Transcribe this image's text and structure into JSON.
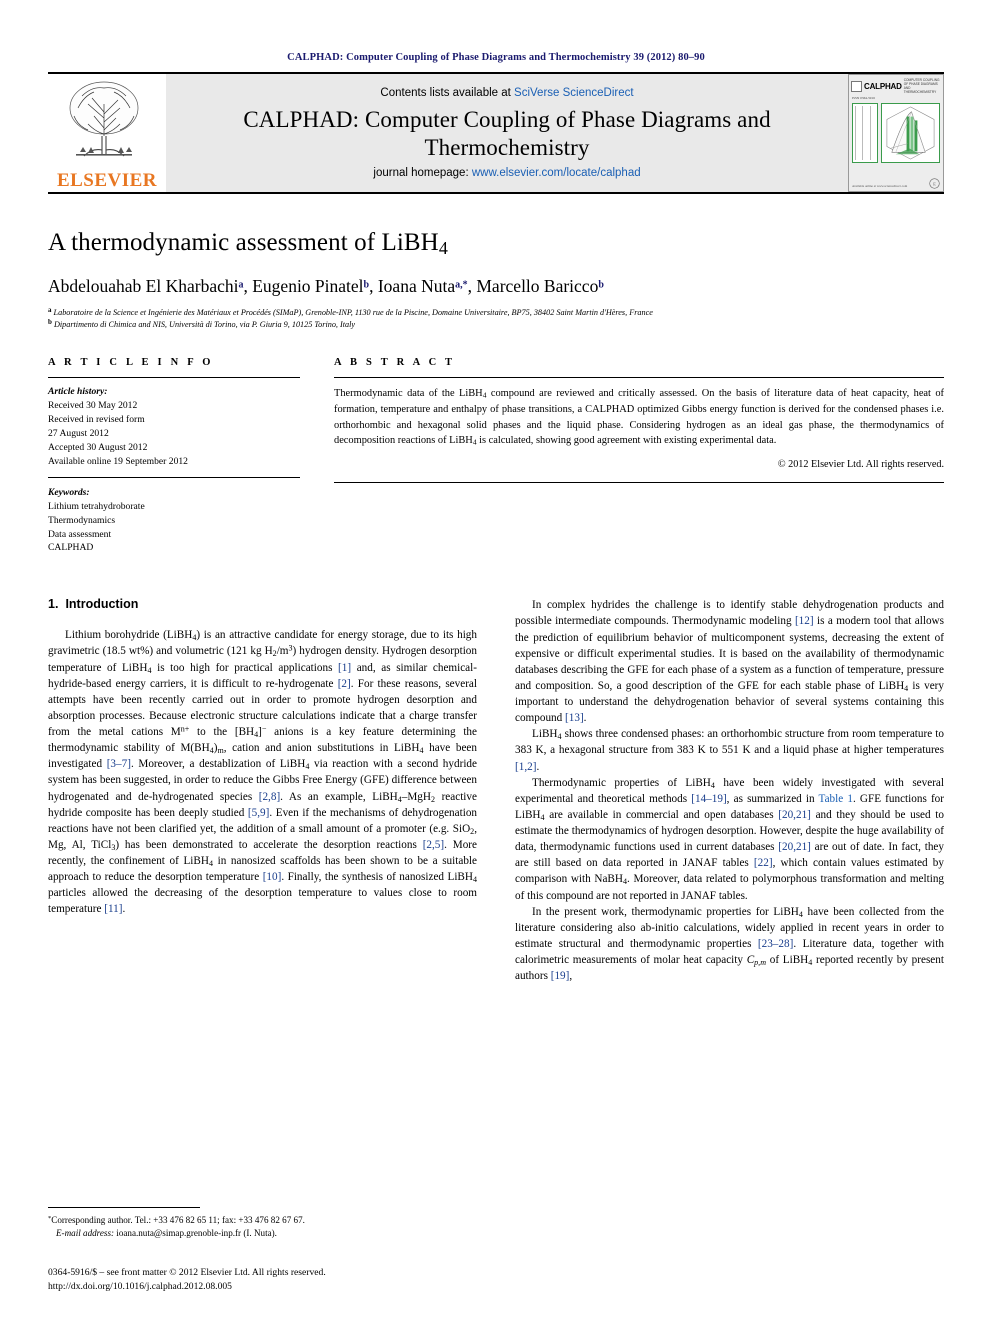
{
  "running_head": "CALPHAD: Computer Coupling of Phase Diagrams and Thermochemistry 39 (2012) 80–90",
  "masthead": {
    "publisher": "ELSEVIER",
    "contents_prefix": "Contents lists available at ",
    "contents_link": "SciVerse ScienceDirect",
    "journal_title": "CALPHAD: Computer Coupling of Phase Diagrams and Thermochemistry",
    "homepage_prefix": "journal homepage: ",
    "homepage_link": "www.elsevier.com/locate/calphad",
    "cover": {
      "brand": "CALPHAD",
      "brand_sub": "COMPUTER COUPLING OF PHASE DIAGRAMS AND THERMOCHEMISTRY",
      "meta": "ISSN 0364-5916",
      "footer_left": "Available online at\nwww.sciencedirect.com"
    }
  },
  "article": {
    "title_main": "A thermodynamic assessment of LiBH",
    "title_sub": "4",
    "authors": [
      {
        "name": "Abdelouahab El Kharbachi",
        "marks": "a",
        "sep": ", "
      },
      {
        "name": "Eugenio Pinatel",
        "marks": "b",
        "sep": ", "
      },
      {
        "name": "Ioana Nuta",
        "marks": "a,*",
        "sep": ", "
      },
      {
        "name": "Marcello Baricco",
        "marks": "b",
        "sep": ""
      }
    ],
    "affiliations": [
      {
        "mark": "a",
        "text": "Laboratoire de la Science et Ingénierie des Matériaux et Procédés (SIMaP), Grenoble-INP, 1130 rue de la Piscine, Domaine Universitaire, BP75, 38402 Saint Martin d'Hères, France"
      },
      {
        "mark": "b",
        "text": "Dipartimento di Chimica and NIS, Università di Torino, via P. Giuria 9, 10125 Torino, Italy"
      }
    ]
  },
  "article_info": {
    "heading": "A R T I C L E   I N F O",
    "history_label": "Article history:",
    "history": [
      "Received 30 May 2012",
      "Received in revised form",
      "27 August 2012",
      "Accepted 30 August 2012",
      "Available online 19 September 2012"
    ],
    "keywords_label": "Keywords:",
    "keywords": [
      "Lithium tetrahydroborate",
      "Thermodynamics",
      "Data assessment",
      "CALPHAD"
    ]
  },
  "abstract": {
    "heading": "A B S T R A C T",
    "copyright": "© 2012 Elsevier Ltd. All rights reserved."
  },
  "sections": {
    "intro_number": "1.",
    "intro_title": "Introduction"
  },
  "footnote": {
    "marker": "*",
    "corresponding": "Corresponding author. Tel.: +33 476 82 65 11; fax: +33 476 82 67 67.",
    "email_label": "E-mail address:",
    "email": "ioana.nuta@simap.grenoble-inp.fr (I. Nuta)."
  },
  "footer": {
    "issn_line": "0364-5916/$ – see front matter © 2012 Elsevier Ltd. All rights reserved.",
    "doi_line": "http://dx.doi.org/10.1016/j.calphad.2012.08.005"
  },
  "colors": {
    "link_blue": "#1a5fb4",
    "reference_blue": "#1a3e8c",
    "elsevier_orange": "#E87722",
    "cover_green": "#3a9b4b",
    "running_head_navy": "#1a1a6e"
  }
}
